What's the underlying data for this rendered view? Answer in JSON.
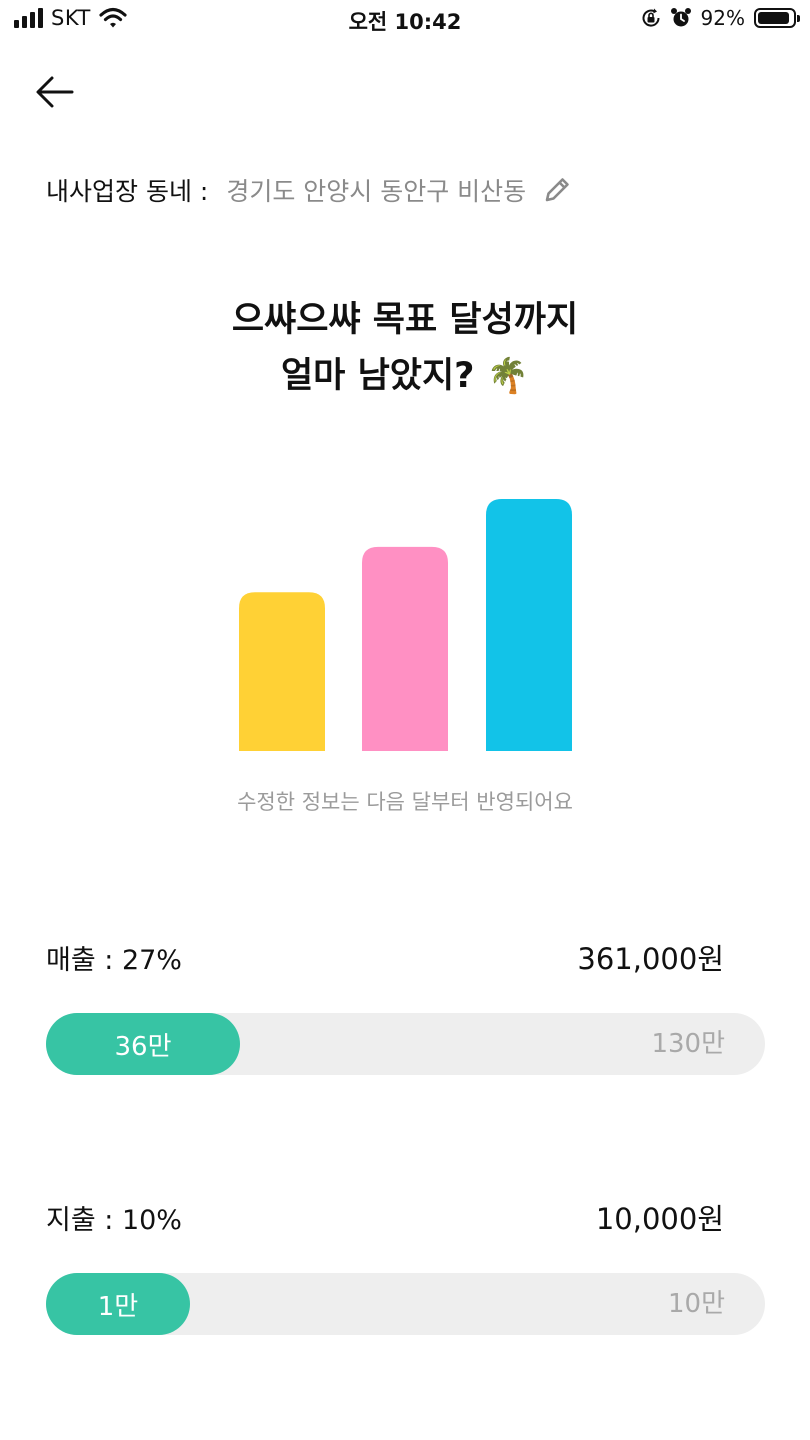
{
  "status_bar": {
    "carrier": "SKT",
    "time": "오전 10:42",
    "battery_percent": "92%",
    "battery_level": 0.92
  },
  "location": {
    "label": "내사업장 동네 :",
    "value": "경기도 안양시 동안구 비산동"
  },
  "headline": {
    "line1": "으쌰으쌰 목표 달성까지",
    "line2": "얼마 남았지?",
    "emoji": "🌴"
  },
  "illustration": {
    "bar_colors": [
      "#ffd135",
      "#ff90c3",
      "#12c3e8"
    ],
    "bar_levels": [
      0.63,
      0.81,
      1.0
    ]
  },
  "note": "수정한 정보는 다음 달부터 반영되어요",
  "sales": {
    "label": "매출 : 27%",
    "amount": "361,000원",
    "current": "36만",
    "goal": "130만",
    "progress": 0.27,
    "color": "#37c4a4"
  },
  "expense": {
    "label": "지출 : 10%",
    "amount": "10,000원",
    "current": "1만",
    "goal": "10만",
    "progress": 0.1,
    "color": "#37c4a4"
  }
}
